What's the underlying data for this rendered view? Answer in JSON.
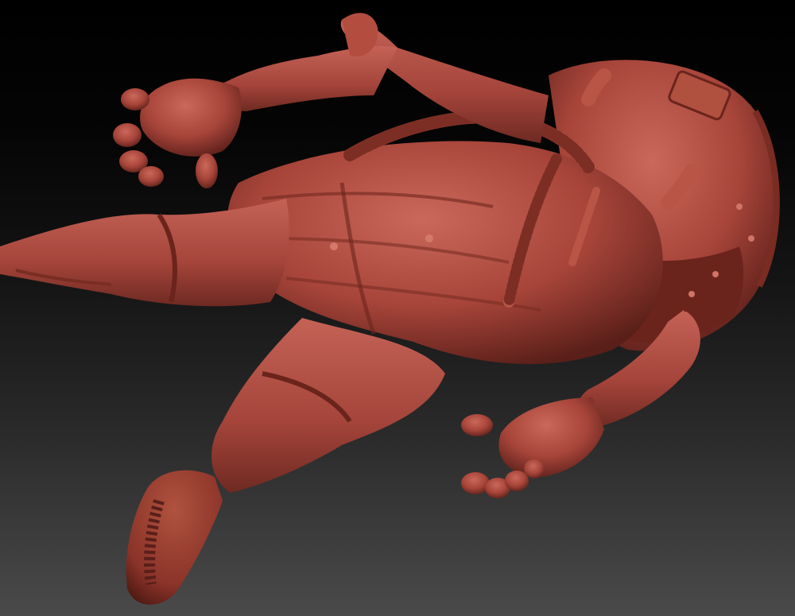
{
  "scene": {
    "subject": "astronaut-sculpt",
    "material_color": "#a8453a",
    "shadow_color": "#5a1f19",
    "highlight_color": "#c9685b",
    "background_top": "#000000",
    "background_bottom": "#4a4a4a"
  }
}
